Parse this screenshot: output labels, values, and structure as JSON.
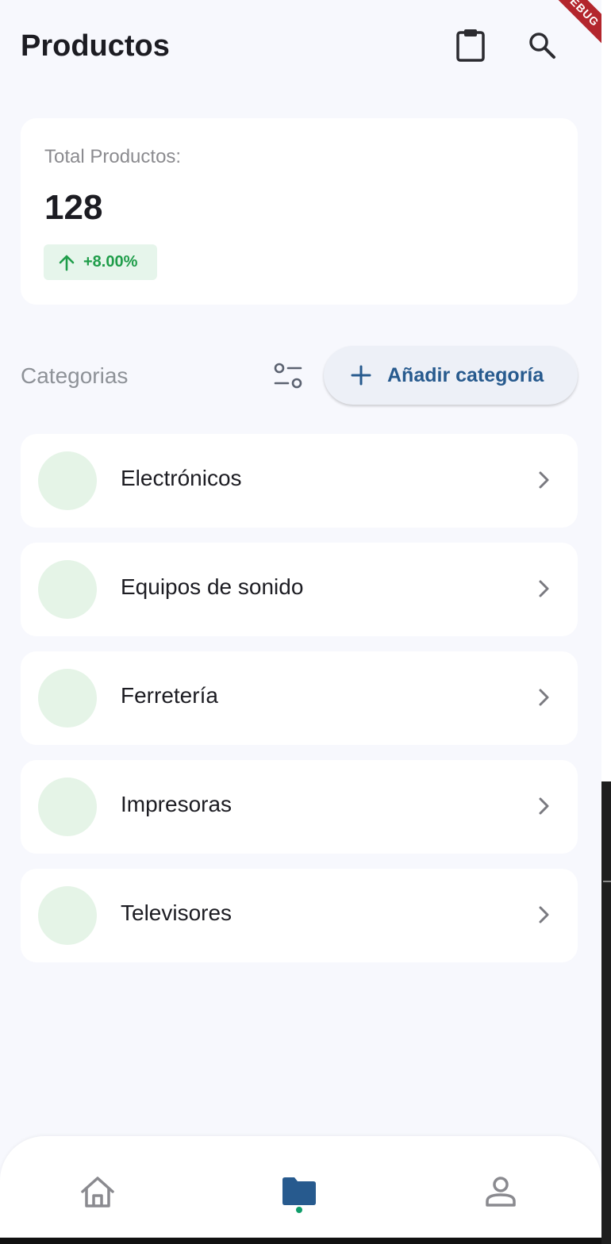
{
  "header": {
    "title": "Productos",
    "debug_label": "DEBUG"
  },
  "stats": {
    "label": "Total Productos:",
    "value": "128",
    "trend": "+8.00%",
    "trend_color": "#1f9d4a"
  },
  "categories_section": {
    "title": "Categorias",
    "add_label": "Añadir categoría"
  },
  "categories": [
    {
      "label": "Electrónicos"
    },
    {
      "label": "Equipos de sonido"
    },
    {
      "label": "Ferretería"
    },
    {
      "label": "Impresoras"
    },
    {
      "label": "Televisores"
    }
  ],
  "nav": {
    "items": [
      "home-icon",
      "folder-icon",
      "person-icon"
    ],
    "active": "folder-icon"
  },
  "colors": {
    "accent": "#275a8e",
    "background": "#f7f8fd",
    "avatar": "#e5f4e7"
  }
}
